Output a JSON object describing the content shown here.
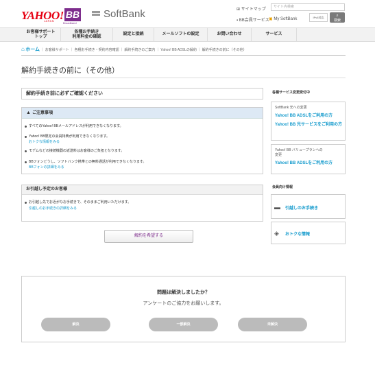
{
  "header": {
    "logo_yahoo": "YAHOO!",
    "logo_yahoo_sub": "JAPAN",
    "logo_bb": "BB",
    "logo_bb_sub": "Broadband",
    "logo_softbank": "SoftBank",
    "sitemap_label": "サイトマップ",
    "search_placeholder": "サイト内検索",
    "bb_member_label": "BB会員サービス",
    "mysoftbank_label": "My SoftBank",
    "ipv6_label": "IPv6対応",
    "search_button_label": "検索"
  },
  "nav": {
    "items": [
      {
        "line1": "お客様サポート",
        "line2": "トップ"
      },
      {
        "line1": "各種お手続き",
        "line2": "利用料金の確認"
      },
      {
        "line1": "設定と接続",
        "line2": ""
      },
      {
        "line1": "メールソフトの設定",
        "line2": ""
      },
      {
        "line1": "お問い合わせ",
        "line2": ""
      },
      {
        "line1": "サービス",
        "line2": ""
      }
    ]
  },
  "breadcrumb": {
    "home": "ホーム",
    "path": "｜ お客様サポート ｜ 各種お手続き・契約内容確認 ｜ 解約手続きのご案内 ｜ Yahoo! BB ADSLの解約 ｜ 解約手続きの前に（その他）"
  },
  "page": {
    "title": "解約手続きの前に（その他）",
    "confirm_heading": "解約手続き前に必ずご確認ください"
  },
  "notice": {
    "heading": "ご注意事項",
    "item1": "すべてのYahoo! BBメールアドレスが利用できなくなります。",
    "item2": "Yahoo! BB限定の会員特典が利用できなくなります。",
    "item2_link": "おトクな情報をみる",
    "item3": "モデムなどの接続機器の返送料はお客様のご負担となります。",
    "item4": "BBフォンどうし、ソフトバンク携帯との無料通話が利用できなくなります。",
    "item4_link": "BBフォンの詳細をみる"
  },
  "moving": {
    "heading": "お引越し予定のお客様",
    "item1": "お引越し先でお近がなお手続きで、そのままご利用いただけます。",
    "item1_link": "引越しのお手続きの詳細をみる"
  },
  "apply_button": "解約を希望する",
  "sidebar": {
    "section1_title": "各種サービス変更受付中",
    "box1_small": "SoftBank 光への変更",
    "box1_link1": "Yahoo! BB ADSLをご利用の方",
    "box1_link2": "Yahoo! BB 光サービスをご利用の方",
    "box2_small1": "Yahoo! BB バリュープランへの",
    "box2_small2": "変更",
    "box2_link1": "Yahoo! BB ADSLをご利用の方",
    "section2_title": "会員向け情報",
    "link_moving": "引越しのお手続き",
    "link_deals": "おトクな情報"
  },
  "survey": {
    "question": "問題は解決しましたか？",
    "sub": "アンケートのご協力をお願いします。",
    "btn_solved": "解決",
    "btn_partial": "一部解決",
    "btn_unsolved": "未解決"
  }
}
